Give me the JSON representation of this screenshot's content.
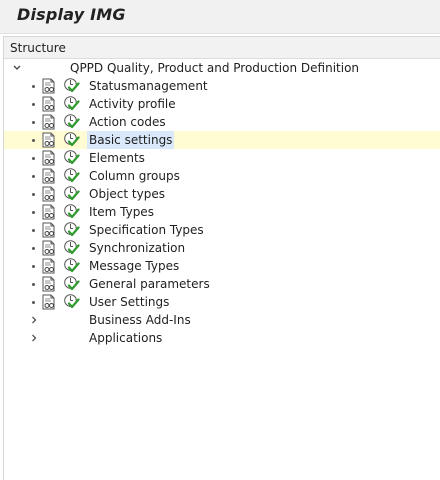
{
  "title": "Display IMG",
  "structure_header": "Structure",
  "tree": {
    "root": {
      "label": "QPPD Quality, Product and Production Definition",
      "expanded": true
    },
    "items": [
      {
        "label": "Statusmanagement"
      },
      {
        "label": "Activity profile"
      },
      {
        "label": "Action codes"
      },
      {
        "label": "Basic settings",
        "selected": true
      },
      {
        "label": "Elements"
      },
      {
        "label": "Column groups"
      },
      {
        "label": "Object types"
      },
      {
        "label": "Item Types"
      },
      {
        "label": "Specification Types"
      },
      {
        "label": "Synchronization"
      },
      {
        "label": "Message Types"
      },
      {
        "label": "General parameters"
      },
      {
        "label": "User Settings"
      }
    ],
    "collapsed_nodes": [
      {
        "label": "Business Add-Ins"
      },
      {
        "label": "Applications"
      }
    ]
  },
  "icons": {
    "root_toggle": "chevron-down-icon",
    "doc": "documentation-icon",
    "execute": "execute-activity-icon",
    "node_toggle": "chevron-right-icon"
  },
  "colors": {
    "selected_row": "#fffbd3",
    "selected_label": "#d9e8fa",
    "check_green": "#2e9a2e"
  }
}
